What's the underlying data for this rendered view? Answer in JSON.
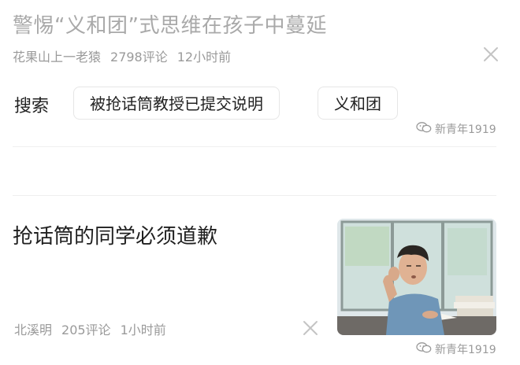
{
  "article1": {
    "title": "警惕“义和团”式思维在孩子中蔓延",
    "author": "花果山上一老猿",
    "comments": "2798评论",
    "time": "12小时前"
  },
  "search": {
    "label": "搜索",
    "chips": [
      "被抢话筒教授已提交说明",
      "义和团"
    ]
  },
  "watermark": {
    "text": "新青年1919",
    "icon": "wechat-icon"
  },
  "article2": {
    "title": "抢话筒的同学必须道歉",
    "author": "北溪明",
    "comments": "205评论",
    "time": "1小时前",
    "thumbnail": "student-photo"
  },
  "colors": {
    "muted_text": "#a9a9a9",
    "text": "#1f1f1f",
    "divider": "#efefef"
  }
}
